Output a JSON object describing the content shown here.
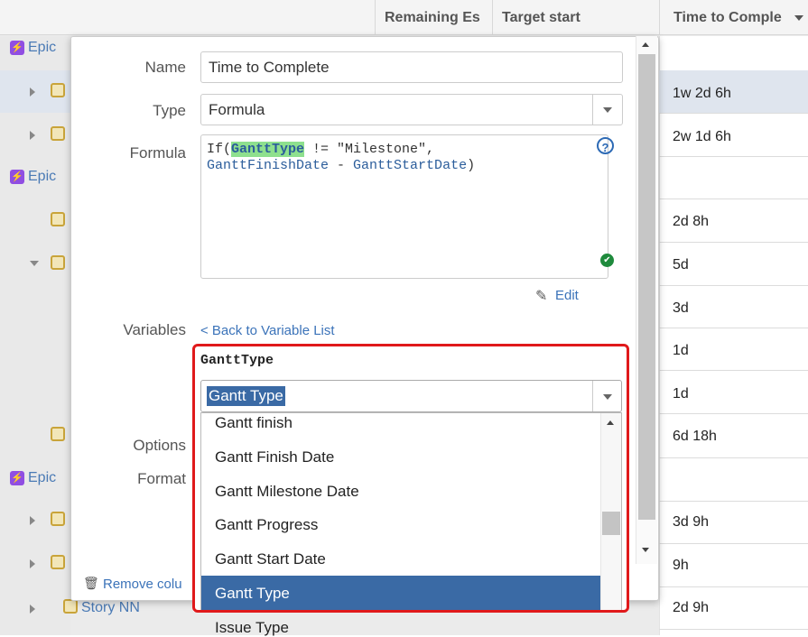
{
  "columns": {
    "remaining": "Remaining Es",
    "target_start": "Target start",
    "time_to_complete": "Time to Comple"
  },
  "left_rows": {
    "epic_label": "Epic",
    "story_label": "Story NN"
  },
  "time_values": [
    "1w 2d 6h",
    "2w 1d 6h",
    "2d 8h",
    "5d",
    "3d",
    "1d",
    "1d",
    "6d 18h",
    "3d 9h",
    "9h",
    "2d 9h"
  ],
  "dialog": {
    "name_label": "Name",
    "name_value": "Time to Complete",
    "type_label": "Type",
    "type_value": "Formula",
    "formula_label": "Formula",
    "formula": {
      "line1_prefix": "If(",
      "line1_var": "GanttType",
      "line1_suffix": " != \"Milestone\",",
      "line2_var1": "GanttFinishDate",
      "line2_op": " - ",
      "line2_var2": "GanttStartDate",
      "line2_suffix": ")"
    },
    "edit_label": "Edit",
    "variables_label": "Variables",
    "back_link": "< Back to Variable List",
    "options_label": "Options",
    "format_label": "Format",
    "remove_label": "Remove colu"
  },
  "variable": {
    "name": "GanttType",
    "selected": "Gantt Type",
    "options": [
      "Gantt finish",
      "Gantt Finish Date",
      "Gantt Milestone Date",
      "Gantt Progress",
      "Gantt Start Date",
      "Gantt Type",
      "Issue Type"
    ],
    "selected_index": 5
  },
  "icons": {
    "help": "question-circle-icon",
    "valid": "check-circle-icon",
    "edit": "pencil-icon",
    "trash": "trash-icon"
  },
  "colors": {
    "accent": "#3a6aa5",
    "highlight_box": "#e0191b",
    "epic": "#904ee2",
    "valid": "#1e8a3c"
  }
}
